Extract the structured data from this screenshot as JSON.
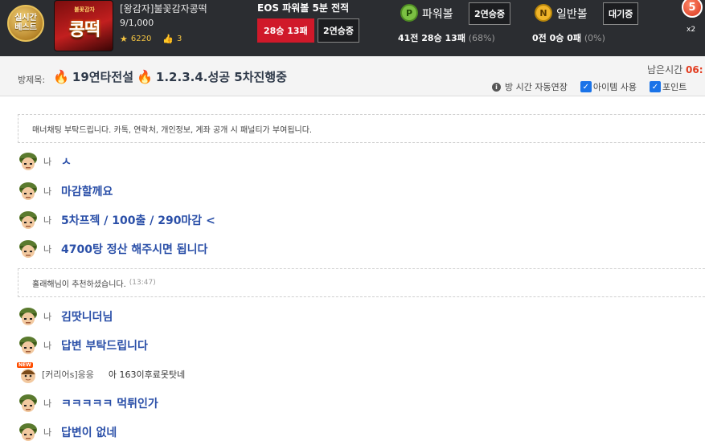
{
  "topbar": {
    "live_badge_line1": "실시간",
    "live_badge_line2": "베스트",
    "thumbnail_small": "불꽃감자",
    "thumbnail_big": "콩떡",
    "room_title": "[왕감자]불꽃감자콩떡",
    "room_count": "9/1,000",
    "stars": "6220",
    "likes": "3",
    "eos_title": "EOS 파워볼 5분 전적",
    "eos_record": "28승 13패",
    "eos_streak": "2연승중",
    "powerball": {
      "icon_letter": "P",
      "label": "파워볼",
      "streak": "2연승중",
      "record": "41전 28승 13패",
      "pct": "(68%)",
      "color": "#7bc043"
    },
    "normalball": {
      "icon_letter": "N",
      "label": "일반볼",
      "streak": "대기중",
      "record": "0전 0승 0패",
      "pct": "(0%)",
      "color": "#f0b429"
    },
    "multiplier_number": "5",
    "multiplier_text": "x2"
  },
  "room": {
    "label": "방제목:",
    "title_part1": "19연타전설",
    "title_part2": "1.2.3.4.성공 5차진행중",
    "remain_label": "남은시간",
    "remain_value": "06:",
    "option_autoext": "방 시간 자동연장",
    "option_items": "아이템 사용",
    "option_points": "포인트"
  },
  "chat": {
    "notice": "매너채팅 부탁드립니다. 카톡, 연락처, 개인정보, 계좌 공개 시 패널티가 부여됩니다.",
    "recommend_user": "홀래해",
    "recommend_text": "님이 추천하셨습니다.",
    "recommend_time": "(13:47)",
    "messages": [
      {
        "sender": "나",
        "text": "ㅅ"
      },
      {
        "sender": "나",
        "text": "마감할께요"
      },
      {
        "sender": "나",
        "text": "5차프젝 / 100출 / 290마감 <"
      },
      {
        "sender": "나",
        "text": "4700탕 정산 해주시면 됩니다"
      },
      {
        "sender": "나",
        "text": "김땃니더님"
      },
      {
        "sender": "나",
        "text": "답변 부탁드립니다"
      },
      {
        "sender": "나",
        "text": "ㅋㅋㅋㅋㅋ 먹튀인가"
      },
      {
        "sender": "나",
        "text": "답변이 없네"
      }
    ],
    "other": {
      "new_tag": "NEW",
      "sender": "[커리어s]응응",
      "text": "아 163이후료못탓네"
    }
  }
}
